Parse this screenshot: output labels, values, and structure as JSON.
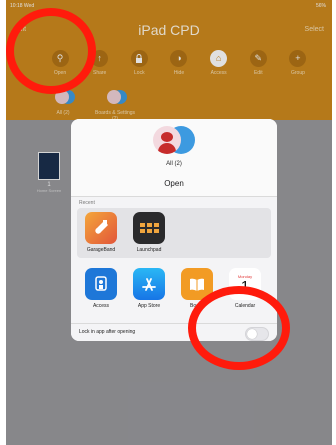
{
  "status_bar": {
    "time": "10:18",
    "date": "Wed",
    "battery": "56%"
  },
  "nav": {
    "left": "Edit",
    "title": "iPad CPD",
    "right": "Select"
  },
  "toolbar": [
    {
      "label": "Open",
      "icon": "share-icon",
      "glyph": "⚲"
    },
    {
      "label": "Share",
      "icon": "share-alt-icon",
      "glyph": "↑"
    },
    {
      "label": "Lock",
      "icon": "lock-icon",
      "glyph": "🔒"
    },
    {
      "label": "Hide",
      "icon": "hide-icon",
      "glyph": "◑"
    },
    {
      "label": "Access",
      "icon": "access-icon",
      "glyph": "⌂"
    },
    {
      "label": "Edit",
      "icon": "edit-icon",
      "glyph": "✎"
    },
    {
      "label": "Group",
      "icon": "plus-icon",
      "glyph": "+"
    }
  ],
  "folder_tabs": [
    {
      "label": "All (2)"
    },
    {
      "label": "Boards & Settings (2)"
    }
  ],
  "board_item": {
    "count": "1",
    "name": "Home Screen"
  },
  "sheet": {
    "name": "All (2)",
    "title": "Open",
    "recent_label": "Recent",
    "recent_apps": [
      {
        "name": "GarageBand",
        "icon": "guitar-icon"
      },
      {
        "name": "Launchpad",
        "icon": "launchpad-icon"
      }
    ],
    "apps": [
      {
        "name": "Access",
        "icon": "access-app-icon"
      },
      {
        "name": "App Store",
        "icon": "app-store-icon"
      },
      {
        "name": "Books",
        "icon": "books-icon"
      },
      {
        "name": "Calendar",
        "icon": "calendar-icon",
        "day": "Monday",
        "date": "1"
      }
    ],
    "lock_label": "Lock in app after opening",
    "lock_on": false
  },
  "annotation_color": "#ff1b0c"
}
